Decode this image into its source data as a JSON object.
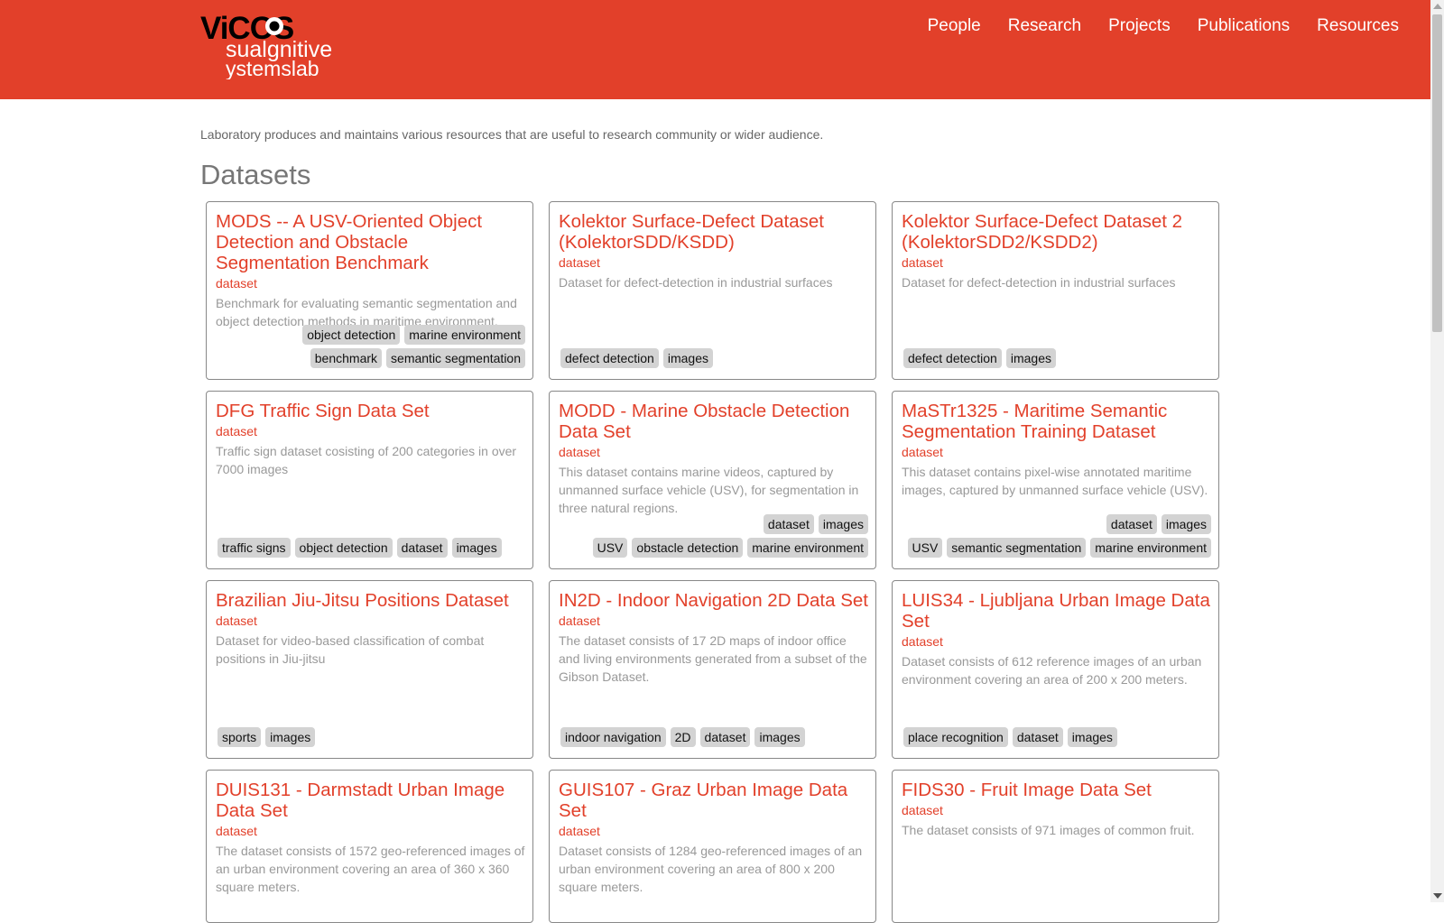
{
  "header": {
    "logo_alt": "ViCoS Visual Cognitive Systems Lab",
    "logo_text": {
      "top": "ViCOS",
      "line1": "sualgnitive",
      "line2": "ystemslab"
    },
    "nav": [
      "People",
      "Research",
      "Projects",
      "Publications",
      "Resources"
    ]
  },
  "intro": "Laboratory produces and maintains various resources that are useful to research community or wider audience.",
  "section_title": "Datasets",
  "cards": [
    {
      "title": "MODS -- A USV-Oriented Object Detection and Obstacle Segmentation Benchmark",
      "type": "dataset",
      "desc": "Benchmark for evaluating semantic segmentation and object detection methods in maritime environment.",
      "tags": [
        "benchmark",
        "semantic segmentation",
        "object detection",
        "marine environment"
      ]
    },
    {
      "title": "Kolektor Surface-Defect Dataset (KolektorSDD/KSDD)",
      "type": "dataset",
      "desc": "Dataset for defect-detection in industrial surfaces",
      "tags": [
        "defect detection",
        "images"
      ]
    },
    {
      "title": "Kolektor Surface-Defect Dataset 2 (KolektorSDD2/KSDD2)",
      "type": "dataset",
      "desc": "Dataset for defect-detection in industrial surfaces",
      "tags": [
        "defect detection",
        "images"
      ]
    },
    {
      "title": "DFG Traffic Sign Data Set",
      "type": "dataset",
      "desc": "Traffic sign dataset cosisting of 200 categories in over 7000 images",
      "tags": [
        "traffic signs",
        "object detection",
        "dataset",
        "images"
      ]
    },
    {
      "title": "MODD - Marine Obstacle Detection Data Set",
      "type": "dataset",
      "desc": "This dataset contains marine videos, captured by unmanned surface vehicle (USV), for segmentation in three natural regions.",
      "tags": [
        "USV",
        "obstacle detection",
        "marine environment",
        "dataset",
        "images"
      ]
    },
    {
      "title": "MaSTr1325 - Maritime Semantic Segmentation Training Dataset",
      "type": "dataset",
      "desc": "This dataset contains pixel-wise annotated maritime images, captured by unmanned surface vehicle (USV).",
      "tags": [
        "USV",
        "semantic segmentation",
        "marine environment",
        "dataset",
        "images"
      ]
    },
    {
      "title": "Brazilian Jiu-Jitsu Positions Dataset",
      "type": "dataset",
      "desc": "Dataset for video-based classification of combat positions in Jiu-jitsu",
      "tags": [
        "sports",
        "images"
      ]
    },
    {
      "title": "IN2D - Indoor Navigation 2D Data Set",
      "type": "dataset",
      "desc": "The dataset consists of 17 2D maps of indoor office and living environments generated from a subset of the Gibson Dataset.",
      "tags": [
        "indoor navigation",
        "2D",
        "dataset",
        "images"
      ]
    },
    {
      "title": "LUIS34 - Ljubljana Urban Image Data Set",
      "type": "dataset",
      "desc": "Dataset consists of 612 reference images of an urban environment covering an area of 200 x 200 meters.",
      "tags": [
        "place recognition",
        "dataset",
        "images"
      ]
    },
    {
      "title": "DUIS131 - Darmstadt Urban Image Data Set",
      "type": "dataset",
      "desc": "The dataset consists of 1572 geo-referenced images of an urban environment covering an area of 360 x 360 square meters.",
      "tags": []
    },
    {
      "title": "GUIS107 - Graz Urban Image Data Set",
      "type": "dataset",
      "desc": "Dataset consists of 1284 geo-referenced images of an urban environment covering an area of 800 x 200 square meters.",
      "tags": []
    },
    {
      "title": "FIDS30 - Fruit Image Data Set",
      "type": "dataset",
      "desc": "The dataset consists of 971 images of common fruit.",
      "tags": []
    }
  ]
}
